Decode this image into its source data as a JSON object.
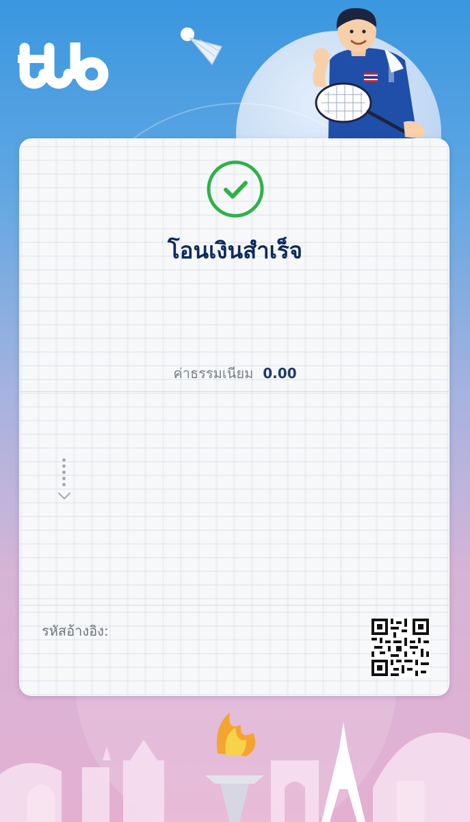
{
  "brand": {
    "logo_text": "ttb"
  },
  "result": {
    "title": "โอนเงินสำเร็จ",
    "status_color": "#2fb14a"
  },
  "fee": {
    "label": "ค่าธรรมเนียม",
    "value": "0.00"
  },
  "reference": {
    "label": "รหัสอ้างอิง:"
  },
  "icons": {
    "success": "check-circle-icon",
    "expand": "chevron-down-icon",
    "qr": "qr-code-icon"
  },
  "colors": {
    "title": "#0d2a5c",
    "accent": "#2fb14a",
    "bg_top": "#3a97e0",
    "bg_bottom": "#e4b0d2"
  }
}
